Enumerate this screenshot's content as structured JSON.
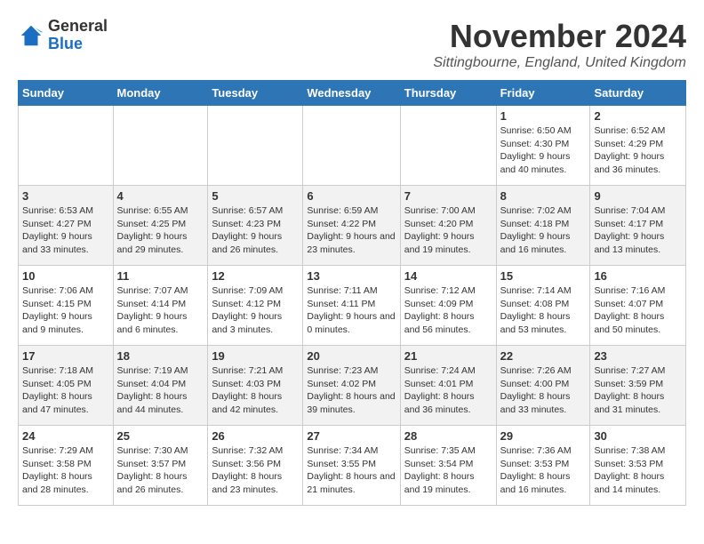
{
  "header": {
    "logo": {
      "general": "General",
      "blue": "Blue"
    },
    "month": "November 2024",
    "location": "Sittingbourne, England, United Kingdom"
  },
  "days_of_week": [
    "Sunday",
    "Monday",
    "Tuesday",
    "Wednesday",
    "Thursday",
    "Friday",
    "Saturday"
  ],
  "weeks": [
    [
      {
        "day": "",
        "info": ""
      },
      {
        "day": "",
        "info": ""
      },
      {
        "day": "",
        "info": ""
      },
      {
        "day": "",
        "info": ""
      },
      {
        "day": "",
        "info": ""
      },
      {
        "day": "1",
        "info": "Sunrise: 6:50 AM\nSunset: 4:30 PM\nDaylight: 9 hours and 40 minutes."
      },
      {
        "day": "2",
        "info": "Sunrise: 6:52 AM\nSunset: 4:29 PM\nDaylight: 9 hours and 36 minutes."
      }
    ],
    [
      {
        "day": "3",
        "info": "Sunrise: 6:53 AM\nSunset: 4:27 PM\nDaylight: 9 hours and 33 minutes."
      },
      {
        "day": "4",
        "info": "Sunrise: 6:55 AM\nSunset: 4:25 PM\nDaylight: 9 hours and 29 minutes."
      },
      {
        "day": "5",
        "info": "Sunrise: 6:57 AM\nSunset: 4:23 PM\nDaylight: 9 hours and 26 minutes."
      },
      {
        "day": "6",
        "info": "Sunrise: 6:59 AM\nSunset: 4:22 PM\nDaylight: 9 hours and 23 minutes."
      },
      {
        "day": "7",
        "info": "Sunrise: 7:00 AM\nSunset: 4:20 PM\nDaylight: 9 hours and 19 minutes."
      },
      {
        "day": "8",
        "info": "Sunrise: 7:02 AM\nSunset: 4:18 PM\nDaylight: 9 hours and 16 minutes."
      },
      {
        "day": "9",
        "info": "Sunrise: 7:04 AM\nSunset: 4:17 PM\nDaylight: 9 hours and 13 minutes."
      }
    ],
    [
      {
        "day": "10",
        "info": "Sunrise: 7:06 AM\nSunset: 4:15 PM\nDaylight: 9 hours and 9 minutes."
      },
      {
        "day": "11",
        "info": "Sunrise: 7:07 AM\nSunset: 4:14 PM\nDaylight: 9 hours and 6 minutes."
      },
      {
        "day": "12",
        "info": "Sunrise: 7:09 AM\nSunset: 4:12 PM\nDaylight: 9 hours and 3 minutes."
      },
      {
        "day": "13",
        "info": "Sunrise: 7:11 AM\nSunset: 4:11 PM\nDaylight: 9 hours and 0 minutes."
      },
      {
        "day": "14",
        "info": "Sunrise: 7:12 AM\nSunset: 4:09 PM\nDaylight: 8 hours and 56 minutes."
      },
      {
        "day": "15",
        "info": "Sunrise: 7:14 AM\nSunset: 4:08 PM\nDaylight: 8 hours and 53 minutes."
      },
      {
        "day": "16",
        "info": "Sunrise: 7:16 AM\nSunset: 4:07 PM\nDaylight: 8 hours and 50 minutes."
      }
    ],
    [
      {
        "day": "17",
        "info": "Sunrise: 7:18 AM\nSunset: 4:05 PM\nDaylight: 8 hours and 47 minutes."
      },
      {
        "day": "18",
        "info": "Sunrise: 7:19 AM\nSunset: 4:04 PM\nDaylight: 8 hours and 44 minutes."
      },
      {
        "day": "19",
        "info": "Sunrise: 7:21 AM\nSunset: 4:03 PM\nDaylight: 8 hours and 42 minutes."
      },
      {
        "day": "20",
        "info": "Sunrise: 7:23 AM\nSunset: 4:02 PM\nDaylight: 8 hours and 39 minutes."
      },
      {
        "day": "21",
        "info": "Sunrise: 7:24 AM\nSunset: 4:01 PM\nDaylight: 8 hours and 36 minutes."
      },
      {
        "day": "22",
        "info": "Sunrise: 7:26 AM\nSunset: 4:00 PM\nDaylight: 8 hours and 33 minutes."
      },
      {
        "day": "23",
        "info": "Sunrise: 7:27 AM\nSunset: 3:59 PM\nDaylight: 8 hours and 31 minutes."
      }
    ],
    [
      {
        "day": "24",
        "info": "Sunrise: 7:29 AM\nSunset: 3:58 PM\nDaylight: 8 hours and 28 minutes."
      },
      {
        "day": "25",
        "info": "Sunrise: 7:30 AM\nSunset: 3:57 PM\nDaylight: 8 hours and 26 minutes."
      },
      {
        "day": "26",
        "info": "Sunrise: 7:32 AM\nSunset: 3:56 PM\nDaylight: 8 hours and 23 minutes."
      },
      {
        "day": "27",
        "info": "Sunrise: 7:34 AM\nSunset: 3:55 PM\nDaylight: 8 hours and 21 minutes."
      },
      {
        "day": "28",
        "info": "Sunrise: 7:35 AM\nSunset: 3:54 PM\nDaylight: 8 hours and 19 minutes."
      },
      {
        "day": "29",
        "info": "Sunrise: 7:36 AM\nSunset: 3:53 PM\nDaylight: 8 hours and 16 minutes."
      },
      {
        "day": "30",
        "info": "Sunrise: 7:38 AM\nSunset: 3:53 PM\nDaylight: 8 hours and 14 minutes."
      }
    ]
  ]
}
